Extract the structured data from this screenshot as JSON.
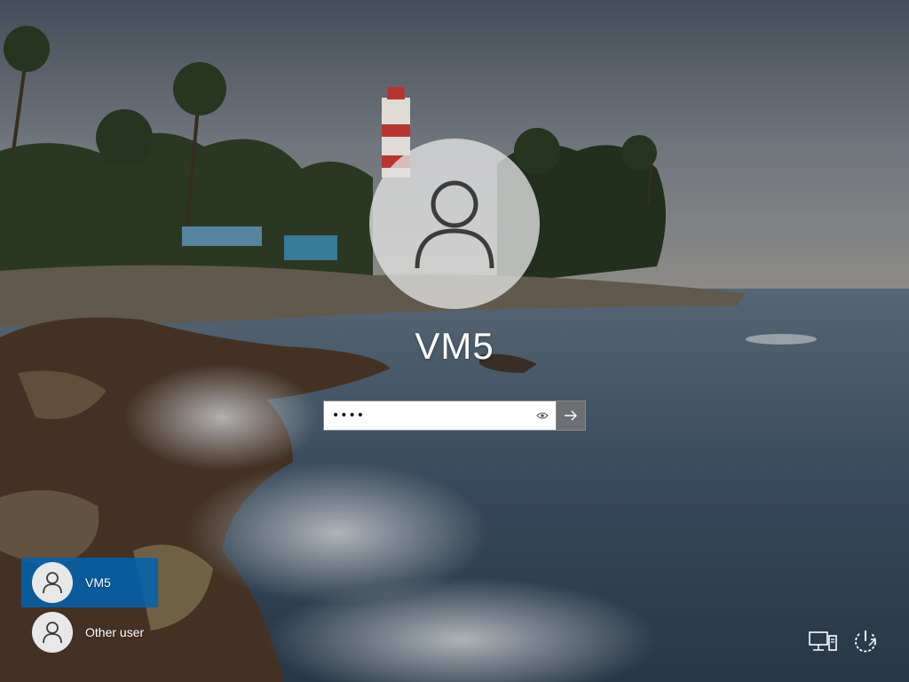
{
  "signin": {
    "username": "VM5",
    "password_value": "••••",
    "reveal_icon": "eye-icon",
    "submit_icon": "arrow-right-icon"
  },
  "users": [
    {
      "label": "VM5",
      "selected": true,
      "icon": "user-icon"
    },
    {
      "label": "Other user",
      "selected": false,
      "icon": "user-icon"
    }
  ],
  "corner": {
    "network_icon": "network-icon",
    "power_icon": "power-icon"
  },
  "colors": {
    "selected_user_bg": "#0063b1",
    "submit_bg": "#6c6f73",
    "avatar_bg": "#e1e1e1",
    "text": "#ffffff"
  }
}
